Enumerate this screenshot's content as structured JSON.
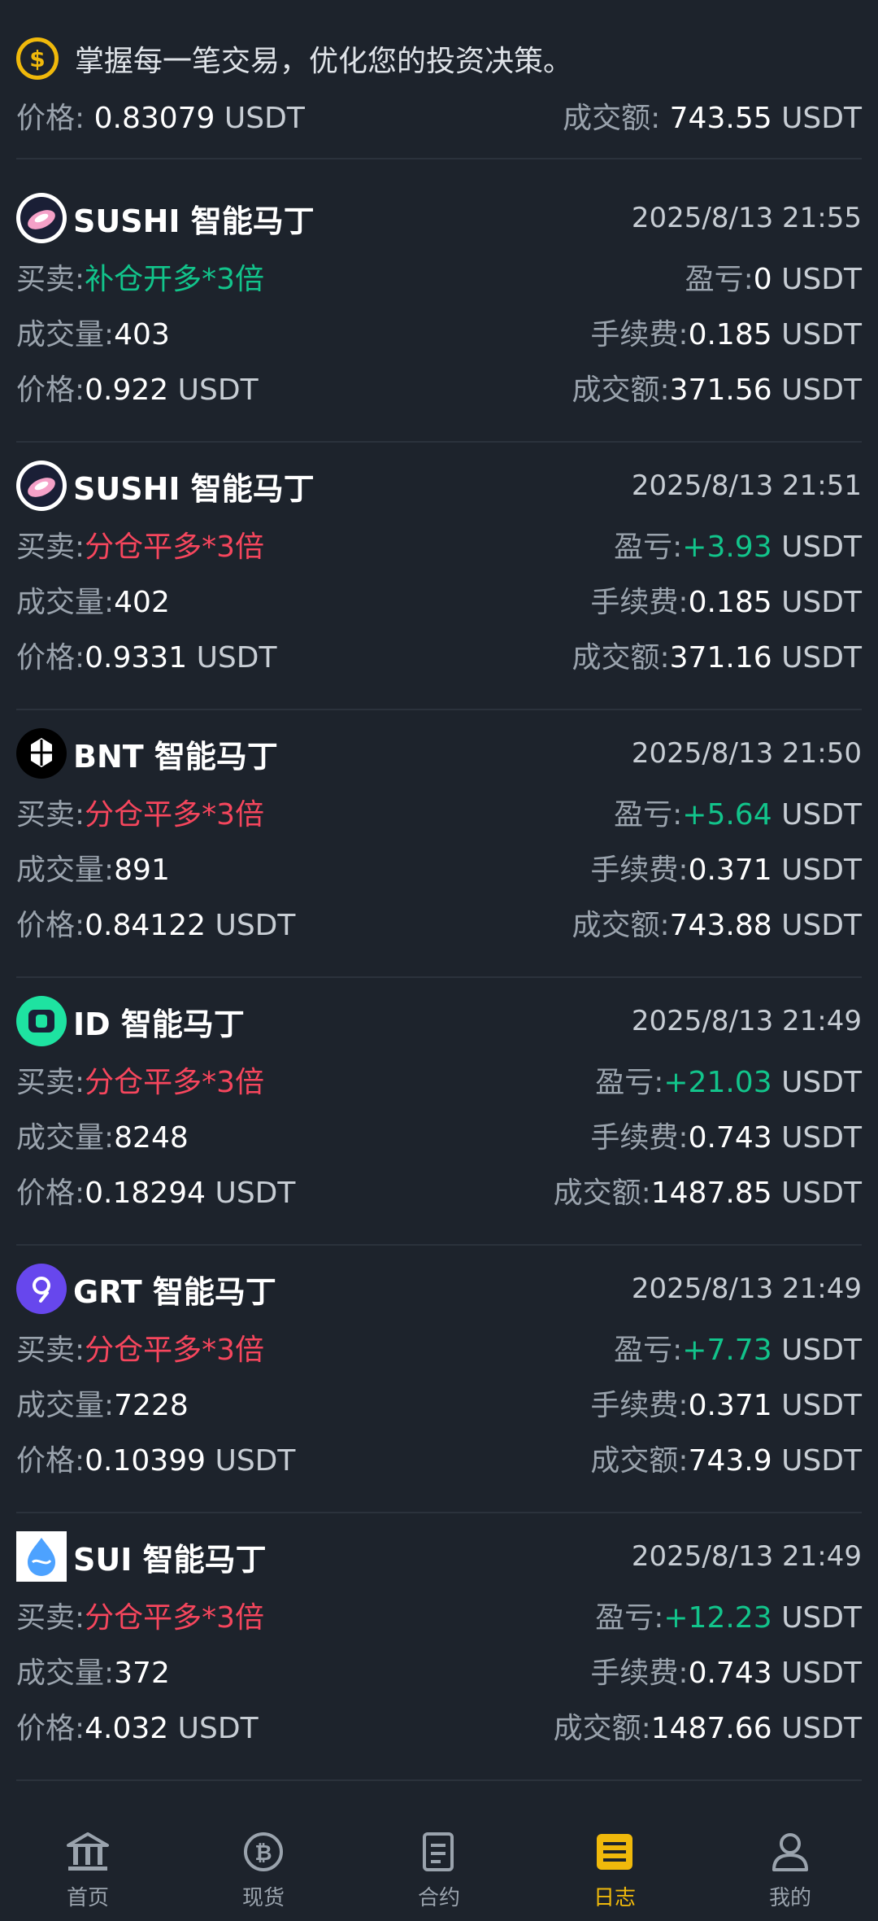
{
  "top_card": {
    "tip": "掌握每一笔交易，优化您的投资决策。",
    "price_label": "价格:",
    "price_value": "0.83079",
    "price_unit": "USDT",
    "amount_label": "成交额:",
    "amount_value": "743.55",
    "amount_unit": "USDT"
  },
  "labels": {
    "side": "买卖:",
    "pnl": "盈亏:",
    "volume": "成交量:",
    "fee": "手续费:",
    "price": "价格:",
    "amount": "成交额:",
    "unit": "USDT"
  },
  "records": [
    {
      "name": "SUSHI 智能马丁",
      "time": "2025/8/13 21:55",
      "action": "补仓开多*3倍",
      "action_type": "open",
      "pnl": "0",
      "volume": "403",
      "fee": "0.185",
      "price": "0.922",
      "amount": "371.56",
      "logo": "sushi-logo-icon"
    },
    {
      "name": "SUSHI 智能马丁",
      "time": "2025/8/13 21:51",
      "action": "分仓平多*3倍",
      "action_type": "close",
      "pnl": "+3.93",
      "volume": "402",
      "fee": "0.185",
      "price": "0.9331",
      "amount": "371.16",
      "logo": "sushi-logo-icon"
    },
    {
      "name": "BNT 智能马丁",
      "time": "2025/8/13 21:50",
      "action": "分仓平多*3倍",
      "action_type": "close",
      "pnl": "+5.64",
      "volume": "891",
      "fee": "0.371",
      "price": "0.84122",
      "amount": "743.88",
      "logo": "bnt-logo-icon"
    },
    {
      "name": "ID 智能马丁",
      "time": "2025/8/13 21:49",
      "action": "分仓平多*3倍",
      "action_type": "close",
      "pnl": "+21.03",
      "volume": "8248",
      "fee": "0.743",
      "price": "0.18294",
      "amount": "1487.85",
      "logo": "id-logo-icon"
    },
    {
      "name": "GRT 智能马丁",
      "time": "2025/8/13 21:49",
      "action": "分仓平多*3倍",
      "action_type": "close",
      "pnl": "+7.73",
      "volume": "7228",
      "fee": "0.371",
      "price": "0.10399",
      "amount": "743.9",
      "logo": "grt-logo-icon"
    },
    {
      "name": "SUI 智能马丁",
      "time": "2025/8/13 21:49",
      "action": "分仓平多*3倍",
      "action_type": "close",
      "pnl": "+12.23",
      "volume": "372",
      "fee": "0.743",
      "price": "4.032",
      "amount": "1487.66",
      "logo": "sui-logo-icon"
    }
  ],
  "colors": {
    "background": "#1d232c",
    "accent": "#f0b90b",
    "green": "#12c48b",
    "red": "#f6465d"
  },
  "nav": {
    "items": [
      {
        "label": "首页",
        "icon": "bank-icon",
        "active": false
      },
      {
        "label": "现货",
        "icon": "bitcoin-icon",
        "active": false
      },
      {
        "label": "合约",
        "icon": "contract-icon",
        "active": false
      },
      {
        "label": "日志",
        "icon": "log-icon",
        "active": true
      },
      {
        "label": "我的",
        "icon": "profile-icon",
        "active": false
      }
    ]
  }
}
